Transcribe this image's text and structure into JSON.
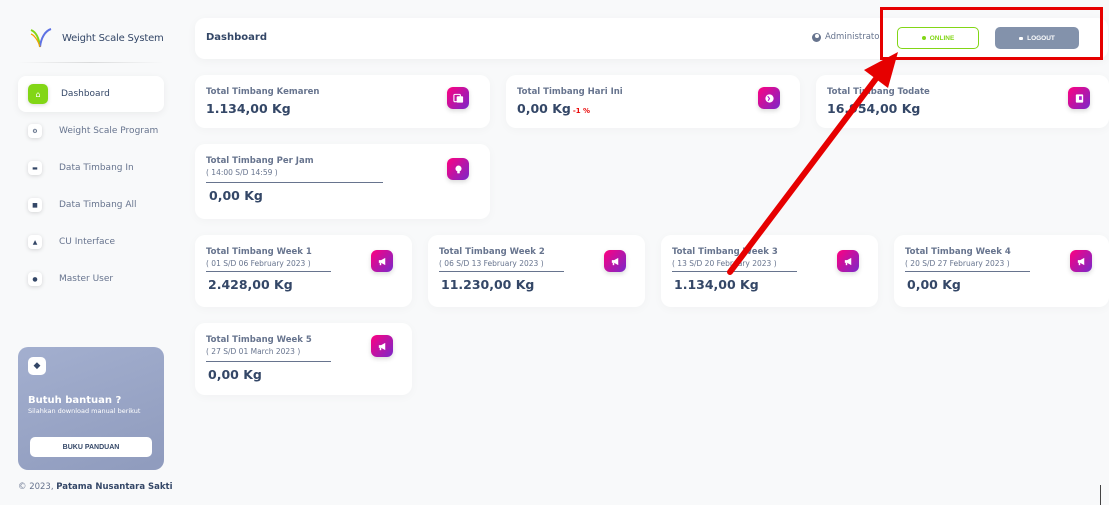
{
  "brand": {
    "name": "Weight Scale System"
  },
  "sidebar": {
    "items": [
      {
        "label": "Dashboard",
        "icon": "home-icon",
        "active": true
      },
      {
        "label": "Weight Scale Program",
        "icon": "settings-icon",
        "active": false
      },
      {
        "label": "Data Timbang In",
        "icon": "truck-icon",
        "active": false
      },
      {
        "label": "Data Timbang All",
        "icon": "lock-icon",
        "active": false
      },
      {
        "label": "CU Interface",
        "icon": "car-icon",
        "active": false
      },
      {
        "label": "Master User",
        "icon": "user-icon",
        "active": false
      }
    ],
    "help": {
      "title": "Butuh bantuan ?",
      "subtitle": "Silahkan download manual berikut",
      "button_label": "BUKU PANDUAN",
      "icon": "diamond-icon"
    },
    "footer": {
      "prefix": "© 2023,",
      "company": "Patama Nusantara Sakti"
    }
  },
  "navbar": {
    "title": "Dashboard",
    "user": "Administrator",
    "online_label": "ONLINE",
    "logout_label": "LOGOUT"
  },
  "cards": {
    "kemaren": {
      "label": "Total Timbang Kemaren",
      "value": "1.134,00 Kg",
      "icon": "document-icon"
    },
    "hari_ini": {
      "label": "Total Timbang Hari Ini",
      "value": "0,00 Kg",
      "change": "-1 %",
      "icon": "globe-icon"
    },
    "todate": {
      "label": "Total Timbang Todate",
      "value": "16.954,00 Kg",
      "icon": "cart-icon"
    },
    "per_jam": {
      "label": "Total Timbang Per Jam",
      "range": "( 14:00 S/D 14:59 )",
      "value": "0,00 Kg",
      "icon": "bulb-icon"
    },
    "week1": {
      "label": "Total Timbang Week 1",
      "range": "( 01 S/D 06 February 2023 )",
      "value": "2.428,00 Kg",
      "icon": "megaphone-icon"
    },
    "week2": {
      "label": "Total Timbang Week 2",
      "range": "( 06 S/D 13 February 2023 )",
      "value": "11.230,00 Kg",
      "icon": "megaphone-icon"
    },
    "week3": {
      "label": "Total Timbang Week 3",
      "range": "( 13 S/D 20 February 2023 )",
      "value": "1.134,00 Kg",
      "icon": "megaphone-icon"
    },
    "week4": {
      "label": "Total Timbang Week 4",
      "range": "( 20 S/D 27 February 2023 )",
      "value": "0,00 Kg",
      "icon": "megaphone-icon"
    },
    "week5": {
      "label": "Total Timbang Week 5",
      "range": "( 27 S/D 01 March 2023 )",
      "value": "0,00 Kg",
      "icon": "megaphone-icon"
    }
  },
  "colors": {
    "accent_green": "#82d616",
    "icon_gradient_start": "#7928ca",
    "icon_gradient_end": "#ff0080",
    "annotation_red": "#e60000",
    "logout_gray": "#8392ab"
  }
}
